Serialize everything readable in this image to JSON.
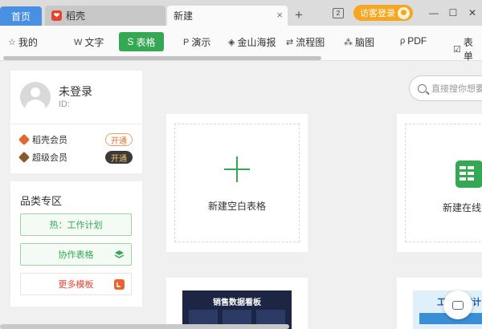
{
  "tabs": {
    "home": "首页",
    "docer": "稻壳",
    "new_tab": "新建",
    "close": "×",
    "add": "+"
  },
  "window": {
    "counter": "2",
    "login": "访客登录",
    "minimize": "—",
    "maximize": "☐",
    "close": "✕"
  },
  "toolbar": {
    "items": [
      {
        "label": "我的",
        "icon": "star-icon"
      },
      {
        "label": "文字",
        "icon": "w-icon"
      },
      {
        "label": "表格",
        "icon": "s-icon"
      },
      {
        "label": "演示",
        "icon": "p-icon"
      },
      {
        "label": "金山海报",
        "icon": "poster-icon"
      },
      {
        "label": "流程图",
        "icon": "flow-icon"
      },
      {
        "label": "脑图",
        "icon": "mindmap-icon"
      },
      {
        "label": "PDF",
        "icon": "pdf-icon"
      },
      {
        "label": "表单",
        "icon": "form-icon"
      }
    ]
  },
  "user": {
    "name": "未登录",
    "id_label": "ID:",
    "memberships": [
      {
        "label": "稻壳会员",
        "action": "开通",
        "color": "#e8632e"
      },
      {
        "label": "超级会员",
        "action": "开通",
        "color": "#8a5a2b"
      }
    ]
  },
  "category": {
    "title": "品类专区",
    "buttons": [
      "热：工作计划",
      "协作表格",
      "更多模板"
    ]
  },
  "search": {
    "placeholder": "直接搜你想要"
  },
  "main": {
    "new_blank": "新建空白表格",
    "new_online": "新建在线文档",
    "template1_title": "销售数据看板",
    "template2_title": "工程进度计"
  },
  "colors": {
    "accent": "#34a853",
    "home_tab": "#4a90e2",
    "login": "#f5a623"
  }
}
